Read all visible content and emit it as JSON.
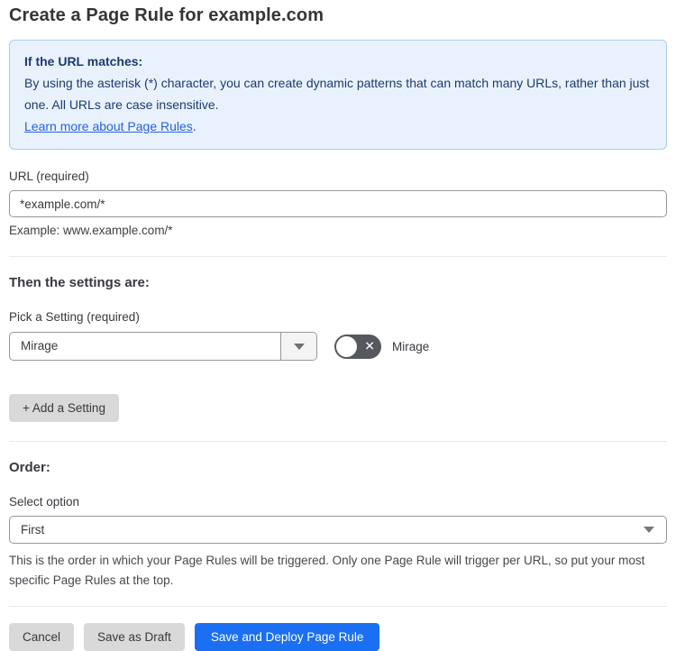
{
  "page": {
    "title": "Create a Page Rule for example.com"
  },
  "info_box": {
    "heading": "If the URL matches:",
    "body": "By using the asterisk (*) character, you can create dynamic patterns that can match many URLs, rather than just one. All URLs are case insensitive.",
    "link_label": "Learn more about Page Rules",
    "link_suffix": "."
  },
  "url_field": {
    "label": "URL (required)",
    "value": "*example.com/*",
    "example": "Example: www.example.com/*"
  },
  "settings_section": {
    "heading": "Then the settings are:",
    "picker_label": "Pick a Setting (required)",
    "picker_value": "Mirage",
    "toggle": {
      "state": "off",
      "glyph": "✕",
      "label": "Mirage"
    },
    "add_button_label": "+ Add a Setting"
  },
  "order_section": {
    "heading": "Order:",
    "select_label": "Select option",
    "select_value": "First",
    "help_text": "This is the order in which your Page Rules will be triggered. Only one Page Rule will trigger per URL, so put your most specific Page Rules at the top."
  },
  "footer": {
    "cancel_label": "Cancel",
    "save_draft_label": "Save as Draft",
    "deploy_label": "Save and Deploy Page Rule"
  },
  "colors": {
    "info_bg": "#e9f2fc",
    "info_border": "#abccee",
    "info_text": "#1d3a6d",
    "link": "#2762d9",
    "primary_button": "#1a6ff2",
    "secondary_button": "#d9d9d9",
    "toggle_off": "#55595e",
    "input_border": "#979797"
  }
}
